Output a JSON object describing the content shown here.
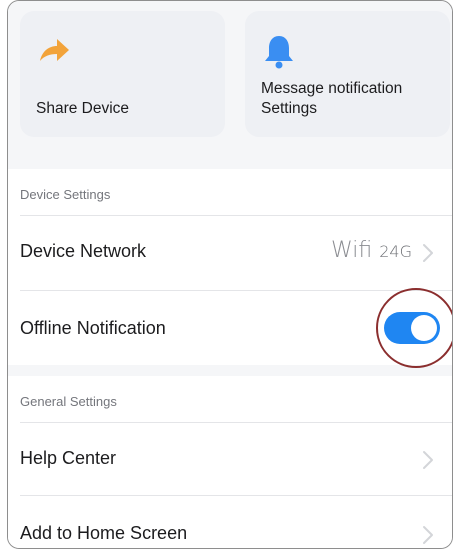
{
  "cards": {
    "share": {
      "label": "Share Device",
      "icon": "share-arrow-icon",
      "icon_color": "#f2a33a"
    },
    "message": {
      "label": "Message notification Settings",
      "icon": "bell-icon",
      "icon_color": "#3a8ef2"
    }
  },
  "device_settings": {
    "header": "Device Settings",
    "network": {
      "label": "Device Network",
      "value_main": "Wifi",
      "value_sub": "24G"
    },
    "offline": {
      "label": "Offline Notification",
      "enabled": true
    }
  },
  "general_settings": {
    "header": "General Settings",
    "help": {
      "label": "Help Center"
    },
    "home": {
      "label": "Add to Home Screen"
    }
  },
  "colors": {
    "accent": "#1f86f2",
    "highlight": "#8b2e2e",
    "background": "#f5f6f8"
  }
}
